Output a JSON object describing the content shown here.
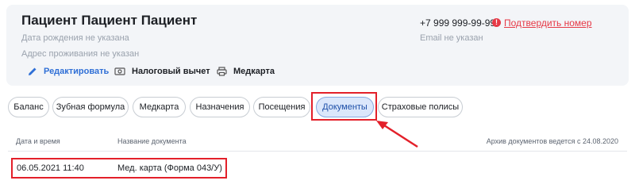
{
  "patient": {
    "full_name": "Пациент Пациент Пациент",
    "birth_date": "Дата рождения не указана",
    "address": "Адрес проживания не указан",
    "phone": "+7 999 999-99-99",
    "phone_warning_symbol": "!",
    "confirm_link": "Подтвердить номер",
    "email": "Email не указан"
  },
  "actions": {
    "edit": "Редактировать",
    "tax": "Налоговый вычет",
    "medcard": "Медкарта"
  },
  "tabs": [
    {
      "label": "Баланс",
      "active": false
    },
    {
      "label": "Зубная формула",
      "active": false
    },
    {
      "label": "Медкарта",
      "active": false
    },
    {
      "label": "Назначения",
      "active": false
    },
    {
      "label": "Посещения",
      "active": false
    },
    {
      "label": "Документы",
      "active": true
    },
    {
      "label": "Страховые полисы",
      "active": false
    }
  ],
  "documents": {
    "columns": [
      "Дата и время",
      "Название документа"
    ],
    "archive_note": "Архив документов ведется с 24.08.2020",
    "rows": [
      {
        "datetime": "06.05.2021 11:40",
        "name": "Мед. карта (Форма 043/У)"
      }
    ]
  },
  "colors": {
    "accent": "#2f6fd6",
    "warning": "#e63946",
    "annotation": "#e3202a",
    "active_tab_bg": "#dbe7fb"
  }
}
